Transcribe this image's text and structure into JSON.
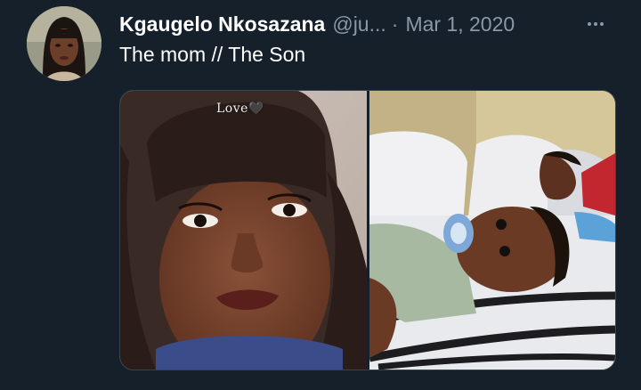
{
  "tweet": {
    "display_name": "Kgaugelo Nkosazana",
    "handle": "@ju...",
    "separator": "·",
    "date": "Mar 1, 2020",
    "text": "The mom // The Son"
  },
  "media": {
    "left_caption": "Love🖤"
  },
  "icons": {
    "more": "more-horizontal-icon"
  },
  "colors": {
    "background": "#15202b",
    "secondary_text": "#8b98a5",
    "primary_text": "#ffffff",
    "border": "#38444d"
  }
}
